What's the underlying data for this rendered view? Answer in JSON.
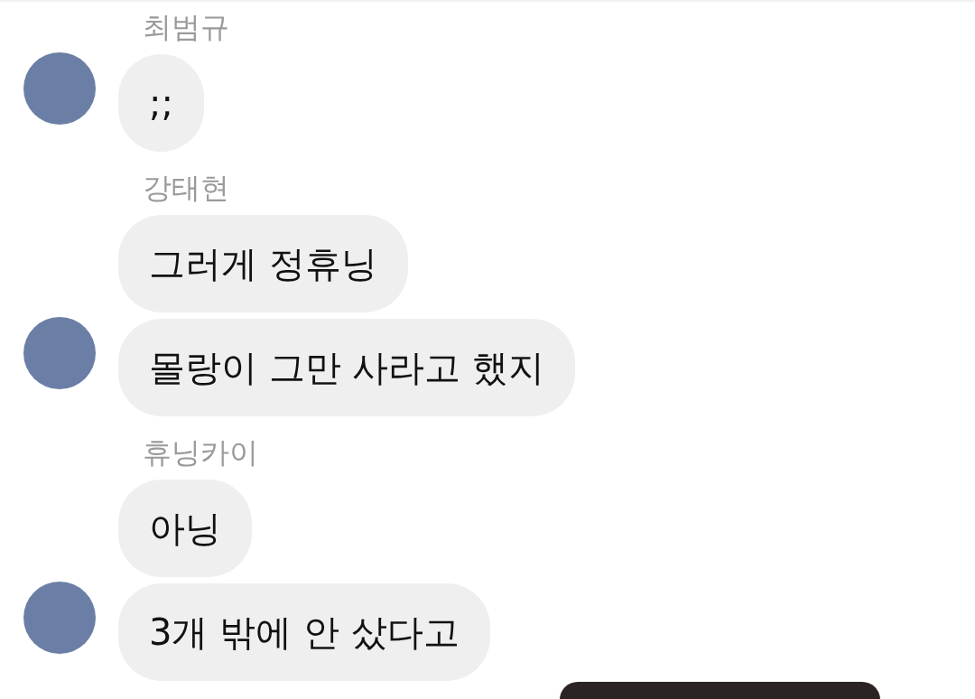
{
  "groups": [
    {
      "sender": "최범규",
      "messages": [
        ";;"
      ]
    },
    {
      "sender": "강태현",
      "messages": [
        "그러게 정휴닝",
        "몰랑이 그만 사라고 했지"
      ]
    },
    {
      "sender": "휴닝카이",
      "messages": [
        "아닝",
        "3개 밖에 안 샀다고"
      ]
    }
  ],
  "attachment": {
    "kind": "photo"
  }
}
